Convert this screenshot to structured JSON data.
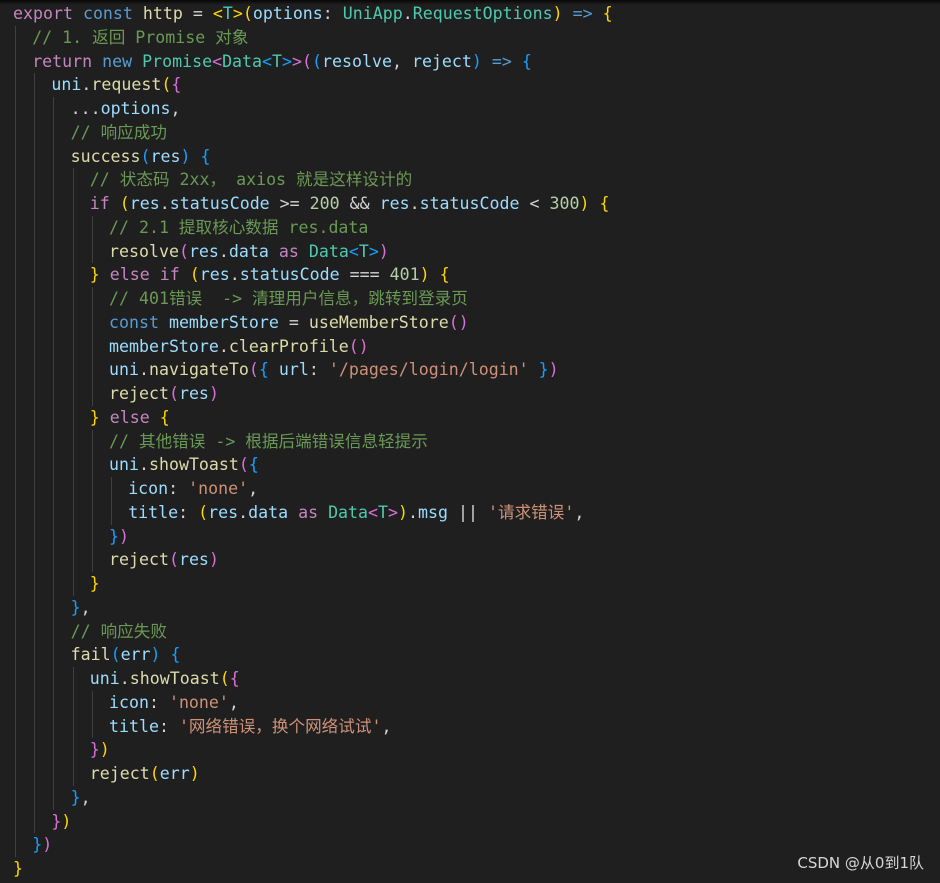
{
  "editor": {
    "theme_colors": {
      "background": "#1f1f1f",
      "keyword": "#569cd6",
      "control": "#c586c0",
      "variable": "#9cdcfe",
      "function": "#dcdcaa",
      "type": "#4ec9b0",
      "string": "#ce9178",
      "number": "#b5cea8",
      "comment": "#6a9955",
      "bracket_level1": "#ffd700",
      "bracket_level2": "#da70d6",
      "bracket_level3": "#179fff"
    },
    "lines": [
      {
        "indent": 0,
        "tokens": [
          [
            "export",
            "ctl"
          ],
          [
            " ",
            "op"
          ],
          [
            "const",
            "kw"
          ],
          [
            " ",
            "op"
          ],
          [
            "http",
            "fn"
          ],
          [
            " = ",
            "op"
          ],
          [
            "<",
            "b1"
          ],
          [
            "T",
            "type"
          ],
          [
            ">",
            "b1"
          ],
          [
            "(",
            "b1"
          ],
          [
            "options",
            "var"
          ],
          [
            ": ",
            "op"
          ],
          [
            "UniApp",
            "type"
          ],
          [
            ".",
            "op"
          ],
          [
            "RequestOptions",
            "type"
          ],
          [
            ")",
            "b1"
          ],
          [
            " ",
            "op"
          ],
          [
            "=>",
            "kw"
          ],
          [
            " ",
            "op"
          ],
          [
            "{",
            "b1"
          ]
        ]
      },
      {
        "indent": 1,
        "tokens": [
          [
            "// 1. 返回 Promise 对象",
            "cmt"
          ]
        ]
      },
      {
        "indent": 1,
        "tokens": [
          [
            "return",
            "ctl"
          ],
          [
            " ",
            "op"
          ],
          [
            "new",
            "kw"
          ],
          [
            " ",
            "op"
          ],
          [
            "Promise",
            "type"
          ],
          [
            "<",
            "b2"
          ],
          [
            "Data",
            "type"
          ],
          [
            "<",
            "b3"
          ],
          [
            "T",
            "type"
          ],
          [
            ">",
            "b3"
          ],
          [
            ">",
            "b2"
          ],
          [
            "(",
            "b2"
          ],
          [
            "(",
            "b3"
          ],
          [
            "resolve",
            "var"
          ],
          [
            ", ",
            "op"
          ],
          [
            "reject",
            "var"
          ],
          [
            ")",
            "b3"
          ],
          [
            " ",
            "op"
          ],
          [
            "=>",
            "kw"
          ],
          [
            " ",
            "op"
          ],
          [
            "{",
            "b3"
          ]
        ]
      },
      {
        "indent": 2,
        "tokens": [
          [
            "uni",
            "var"
          ],
          [
            ".",
            "op"
          ],
          [
            "request",
            "fn"
          ],
          [
            "(",
            "b1"
          ],
          [
            "{",
            "b2"
          ]
        ]
      },
      {
        "indent": 3,
        "tokens": [
          [
            "...",
            "op"
          ],
          [
            "options",
            "var"
          ],
          [
            ",",
            "op"
          ]
        ]
      },
      {
        "indent": 3,
        "tokens": [
          [
            "// 响应成功",
            "cmt"
          ]
        ]
      },
      {
        "indent": 3,
        "tokens": [
          [
            "success",
            "fn"
          ],
          [
            "(",
            "b3"
          ],
          [
            "res",
            "var"
          ],
          [
            ")",
            "b3"
          ],
          [
            " ",
            "op"
          ],
          [
            "{",
            "b3"
          ]
        ]
      },
      {
        "indent": 4,
        "tokens": [
          [
            "// 状态码 2xx， axios 就是这样设计的",
            "cmt"
          ]
        ]
      },
      {
        "indent": 4,
        "tokens": [
          [
            "if",
            "ctl"
          ],
          [
            " ",
            "op"
          ],
          [
            "(",
            "b1"
          ],
          [
            "res",
            "var"
          ],
          [
            ".",
            "op"
          ],
          [
            "statusCode",
            "var"
          ],
          [
            " >= ",
            "op"
          ],
          [
            "200",
            "num"
          ],
          [
            " && ",
            "op"
          ],
          [
            "res",
            "var"
          ],
          [
            ".",
            "op"
          ],
          [
            "statusCode",
            "var"
          ],
          [
            " < ",
            "op"
          ],
          [
            "300",
            "num"
          ],
          [
            ")",
            "b1"
          ],
          [
            " ",
            "op"
          ],
          [
            "{",
            "b1"
          ]
        ]
      },
      {
        "indent": 5,
        "tokens": [
          [
            "// 2.1 提取核心数据 res.data",
            "cmt"
          ]
        ]
      },
      {
        "indent": 5,
        "tokens": [
          [
            "resolve",
            "fn"
          ],
          [
            "(",
            "b2"
          ],
          [
            "res",
            "var"
          ],
          [
            ".",
            "op"
          ],
          [
            "data",
            "var"
          ],
          [
            " ",
            "op"
          ],
          [
            "as",
            "ctl"
          ],
          [
            " ",
            "op"
          ],
          [
            "Data",
            "type"
          ],
          [
            "<",
            "b3"
          ],
          [
            "T",
            "type"
          ],
          [
            ">",
            "b3"
          ],
          [
            ")",
            "b2"
          ]
        ]
      },
      {
        "indent": 4,
        "tokens": [
          [
            "}",
            "b1"
          ],
          [
            " ",
            "op"
          ],
          [
            "else",
            "ctl"
          ],
          [
            " ",
            "op"
          ],
          [
            "if",
            "ctl"
          ],
          [
            " ",
            "op"
          ],
          [
            "(",
            "b1"
          ],
          [
            "res",
            "var"
          ],
          [
            ".",
            "op"
          ],
          [
            "statusCode",
            "var"
          ],
          [
            " === ",
            "op"
          ],
          [
            "401",
            "num"
          ],
          [
            ")",
            "b1"
          ],
          [
            " ",
            "op"
          ],
          [
            "{",
            "b1"
          ]
        ]
      },
      {
        "indent": 5,
        "tokens": [
          [
            "// 401错误  -> 清理用户信息，跳转到登录页",
            "cmt"
          ]
        ]
      },
      {
        "indent": 5,
        "tokens": [
          [
            "const",
            "kw"
          ],
          [
            " ",
            "op"
          ],
          [
            "memberStore",
            "var"
          ],
          [
            " = ",
            "op"
          ],
          [
            "useMemberStore",
            "fn"
          ],
          [
            "(",
            "b2"
          ],
          [
            ")",
            "b2"
          ]
        ]
      },
      {
        "indent": 5,
        "tokens": [
          [
            "memberStore",
            "var"
          ],
          [
            ".",
            "op"
          ],
          [
            "clearProfile",
            "fn"
          ],
          [
            "(",
            "b2"
          ],
          [
            ")",
            "b2"
          ]
        ]
      },
      {
        "indent": 5,
        "tokens": [
          [
            "uni",
            "var"
          ],
          [
            ".",
            "op"
          ],
          [
            "navigateTo",
            "fn"
          ],
          [
            "(",
            "b2"
          ],
          [
            "{",
            "b3"
          ],
          [
            " ",
            "op"
          ],
          [
            "url",
            "var"
          ],
          [
            ": ",
            "op"
          ],
          [
            "'/pages/login/login'",
            "str"
          ],
          [
            " ",
            "op"
          ],
          [
            "}",
            "b3"
          ],
          [
            ")",
            "b2"
          ]
        ]
      },
      {
        "indent": 5,
        "tokens": [
          [
            "reject",
            "fn"
          ],
          [
            "(",
            "b2"
          ],
          [
            "res",
            "var"
          ],
          [
            ")",
            "b2"
          ]
        ]
      },
      {
        "indent": 4,
        "tokens": [
          [
            "}",
            "b1"
          ],
          [
            " ",
            "op"
          ],
          [
            "else",
            "ctl"
          ],
          [
            " ",
            "op"
          ],
          [
            "{",
            "b1"
          ]
        ]
      },
      {
        "indent": 5,
        "tokens": [
          [
            "// 其他错误 -> 根据后端错误信息轻提示",
            "cmt"
          ]
        ]
      },
      {
        "indent": 5,
        "tokens": [
          [
            "uni",
            "var"
          ],
          [
            ".",
            "op"
          ],
          [
            "showToast",
            "fn"
          ],
          [
            "(",
            "b2"
          ],
          [
            "{",
            "b3"
          ]
        ]
      },
      {
        "indent": 6,
        "tokens": [
          [
            "icon",
            "var"
          ],
          [
            ": ",
            "op"
          ],
          [
            "'none'",
            "str"
          ],
          [
            ",",
            "op"
          ]
        ]
      },
      {
        "indent": 6,
        "tokens": [
          [
            "title",
            "var"
          ],
          [
            ": ",
            "op"
          ],
          [
            "(",
            "b1"
          ],
          [
            "res",
            "var"
          ],
          [
            ".",
            "op"
          ],
          [
            "data",
            "var"
          ],
          [
            " ",
            "op"
          ],
          [
            "as",
            "ctl"
          ],
          [
            " ",
            "op"
          ],
          [
            "Data",
            "type"
          ],
          [
            "<",
            "b2"
          ],
          [
            "T",
            "type"
          ],
          [
            ">",
            "b2"
          ],
          [
            ")",
            "b1"
          ],
          [
            ".",
            "op"
          ],
          [
            "msg",
            "var"
          ],
          [
            " || ",
            "op"
          ],
          [
            "'请求错误'",
            "str"
          ],
          [
            ",",
            "op"
          ]
        ]
      },
      {
        "indent": 5,
        "tokens": [
          [
            "}",
            "b3"
          ],
          [
            ")",
            "b2"
          ]
        ]
      },
      {
        "indent": 5,
        "tokens": [
          [
            "reject",
            "fn"
          ],
          [
            "(",
            "b2"
          ],
          [
            "res",
            "var"
          ],
          [
            ")",
            "b2"
          ]
        ]
      },
      {
        "indent": 4,
        "tokens": [
          [
            "}",
            "b1"
          ]
        ]
      },
      {
        "indent": 3,
        "tokens": [
          [
            "}",
            "b3"
          ],
          [
            ",",
            "op"
          ]
        ]
      },
      {
        "indent": 3,
        "tokens": [
          [
            "// 响应失败",
            "cmt"
          ]
        ]
      },
      {
        "indent": 3,
        "tokens": [
          [
            "fail",
            "fn"
          ],
          [
            "(",
            "b3"
          ],
          [
            "err",
            "var"
          ],
          [
            ")",
            "b3"
          ],
          [
            " ",
            "op"
          ],
          [
            "{",
            "b3"
          ]
        ]
      },
      {
        "indent": 4,
        "tokens": [
          [
            "uni",
            "var"
          ],
          [
            ".",
            "op"
          ],
          [
            "showToast",
            "fn"
          ],
          [
            "(",
            "b1"
          ],
          [
            "{",
            "b2"
          ]
        ]
      },
      {
        "indent": 5,
        "tokens": [
          [
            "icon",
            "var"
          ],
          [
            ": ",
            "op"
          ],
          [
            "'none'",
            "str"
          ],
          [
            ",",
            "op"
          ]
        ]
      },
      {
        "indent": 5,
        "tokens": [
          [
            "title",
            "var"
          ],
          [
            ": ",
            "op"
          ],
          [
            "'网络错误，换个网络试试'",
            "str"
          ],
          [
            ",",
            "op"
          ]
        ]
      },
      {
        "indent": 4,
        "tokens": [
          [
            "}",
            "b2"
          ],
          [
            ")",
            "b1"
          ]
        ]
      },
      {
        "indent": 4,
        "tokens": [
          [
            "reject",
            "fn"
          ],
          [
            "(",
            "b1"
          ],
          [
            "err",
            "var"
          ],
          [
            ")",
            "b1"
          ]
        ]
      },
      {
        "indent": 3,
        "tokens": [
          [
            "}",
            "b3"
          ],
          [
            ",",
            "op"
          ]
        ]
      },
      {
        "indent": 2,
        "tokens": [
          [
            "}",
            "b2"
          ],
          [
            ")",
            "b1"
          ]
        ]
      },
      {
        "indent": 1,
        "tokens": [
          [
            "}",
            "b3"
          ],
          [
            ")",
            "b2"
          ]
        ]
      },
      {
        "indent": 0,
        "tokens": [
          [
            "}",
            "b1"
          ]
        ]
      }
    ]
  },
  "watermark": {
    "text": "CSDN @从0到1队"
  }
}
